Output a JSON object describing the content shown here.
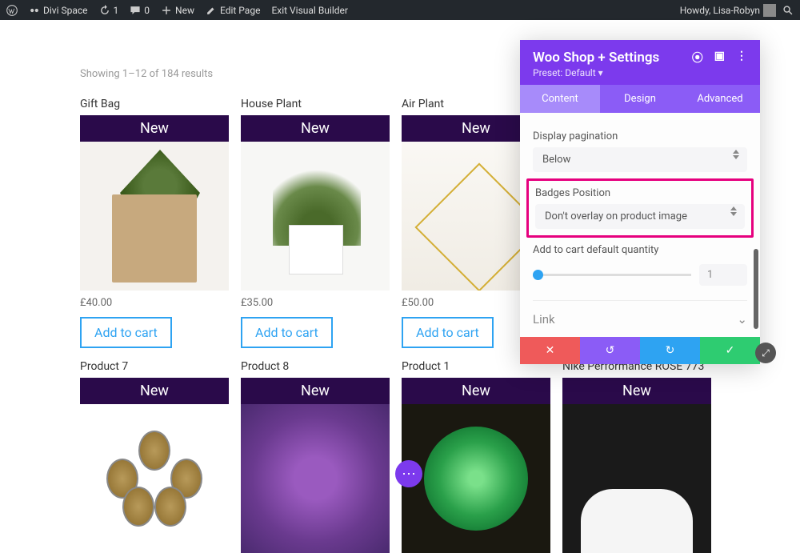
{
  "adminbar": {
    "site": "Divi Space",
    "refresh": "1",
    "comments": "0",
    "new": "New",
    "edit": "Edit Page",
    "exit": "Exit Visual Builder",
    "howdy": "Howdy, Lisa-Robyn"
  },
  "shop": {
    "results": "Showing 1–12 of 184 results",
    "addcart": "Add to cart",
    "badge": "New",
    "products": [
      {
        "title": "Gift Bag",
        "price": "£40.00"
      },
      {
        "title": "House Plant",
        "price": "£35.00"
      },
      {
        "title": "Air Plant",
        "price": "£50.00"
      },
      {
        "title": "Product 7"
      },
      {
        "title": "Product 8"
      },
      {
        "title": "Product 1"
      },
      {
        "title": "Nike Performance ROSE 773"
      }
    ]
  },
  "panel": {
    "title": "Woo Shop + Settings",
    "preset": "Preset: Default",
    "tabs": {
      "content": "Content",
      "design": "Design",
      "advanced": "Advanced"
    },
    "pagination": {
      "label": "Display pagination",
      "value": "Below"
    },
    "badges": {
      "label": "Badges Position",
      "value": "Don't overlay on product image"
    },
    "qty": {
      "label": "Add to cart default quantity",
      "value": "1"
    },
    "link": "Link"
  }
}
